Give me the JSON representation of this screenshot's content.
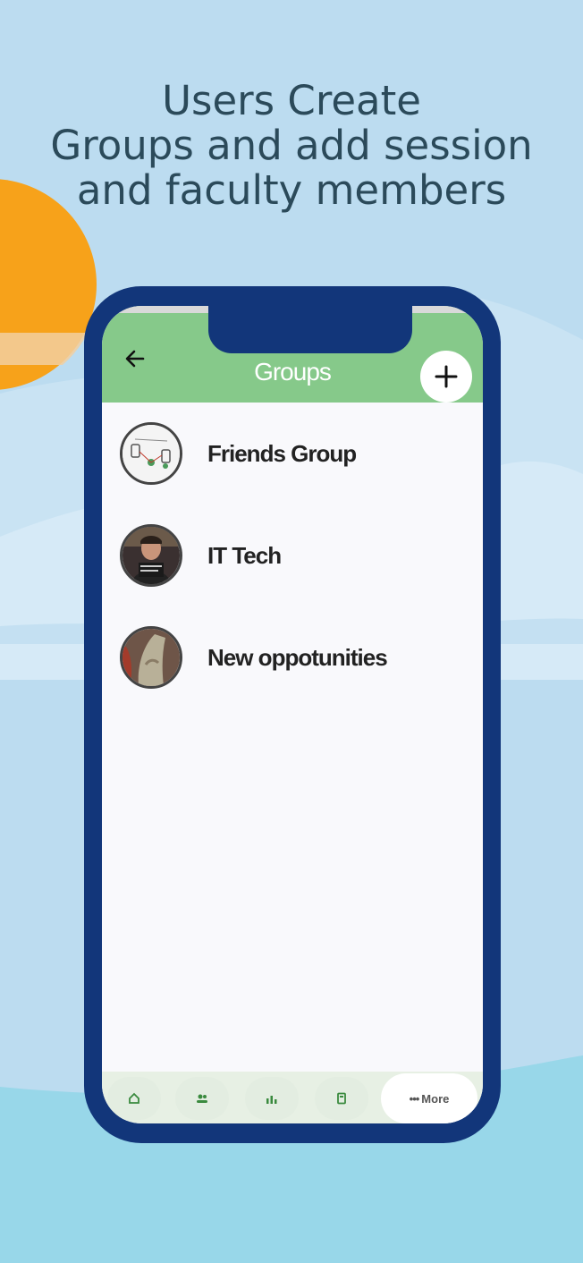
{
  "headline": {
    "line1": "Users Create",
    "line2": "Groups and add session",
    "line3": "and faculty members"
  },
  "app": {
    "title": "Groups",
    "add_icon": "plus-icon",
    "back_icon": "arrow-left-icon"
  },
  "groups": [
    {
      "name": "Friends Group",
      "avatar": "network-diagram-image"
    },
    {
      "name": "IT Tech",
      "avatar": "person-photo"
    },
    {
      "name": "New oppotunities",
      "avatar": "hand-photo"
    }
  ],
  "tabs": {
    "items": [
      "home-icon",
      "people-icon",
      "chart-icon",
      "book-icon"
    ],
    "more_label": "More",
    "more_icon": "ellipsis-icon"
  },
  "colors": {
    "background": "#bcdcf0",
    "sun": "#f7a21a",
    "phone_frame": "#12367a",
    "app_bar": "#86c98a",
    "headline": "#2b4a5a",
    "icon_green": "#3a8a3e"
  }
}
